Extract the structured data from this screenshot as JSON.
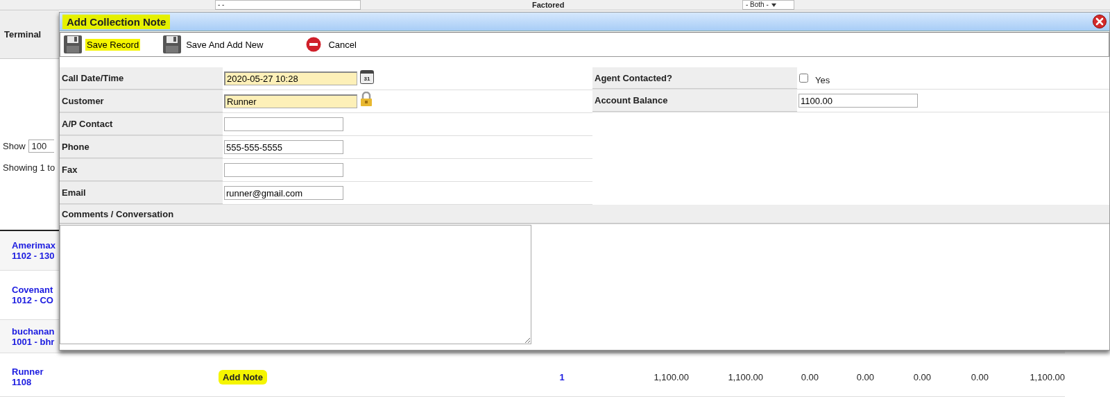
{
  "background": {
    "top_filter": {
      "field_value": "- -",
      "label": "Factored",
      "select_value": "- Both -"
    },
    "terminal_label": "Terminal",
    "show_label": "Show",
    "page_size": "100",
    "showing_text": "Showing 1 to",
    "rows": [
      {
        "name": "Amerimax",
        "code": "1102 - 130"
      },
      {
        "name": "Covenant",
        "code": "1012 - CO"
      },
      {
        "name": "buchanan",
        "code": "1001 - bhr"
      },
      {
        "name": "Runner",
        "code": "1108",
        "action": {
          "label": "Add Note",
          "highlighted": true
        },
        "count": "1",
        "cells": [
          "1,100.00",
          "1,100.00",
          "0.00",
          "0.00",
          "0.00",
          "0.00",
          "1,100.00"
        ]
      }
    ]
  },
  "dialog": {
    "title": "Add Collection Note",
    "title_highlighted": true,
    "toolbar": [
      {
        "kind": "save",
        "label": "Save Record",
        "highlighted": true
      },
      {
        "kind": "save",
        "label": "Save And Add New",
        "highlighted": false
      },
      {
        "kind": "cancel",
        "label": "Cancel",
        "highlighted": false
      }
    ],
    "left_fields": [
      {
        "label": "Call Date/Time",
        "kind": "date",
        "value": "2020-05-27 10:28",
        "icon_label": "31"
      },
      {
        "label": "Customer",
        "kind": "locked",
        "value": "Runner"
      },
      {
        "label": "A/P Contact",
        "kind": "text"
      },
      {
        "label": "Phone",
        "kind": "text",
        "value": "555-555-5555"
      },
      {
        "label": "Fax",
        "kind": "text"
      },
      {
        "label": "Email",
        "kind": "text",
        "value": "runner@gmail.com"
      }
    ],
    "right_fields": [
      {
        "label": "Agent Contacted?",
        "kind": "checkbox",
        "checked": false,
        "option": "Yes"
      },
      {
        "label": "Account Balance",
        "kind": "text",
        "value": "1100.00"
      }
    ],
    "comments_label": "Comments / Conversation"
  }
}
